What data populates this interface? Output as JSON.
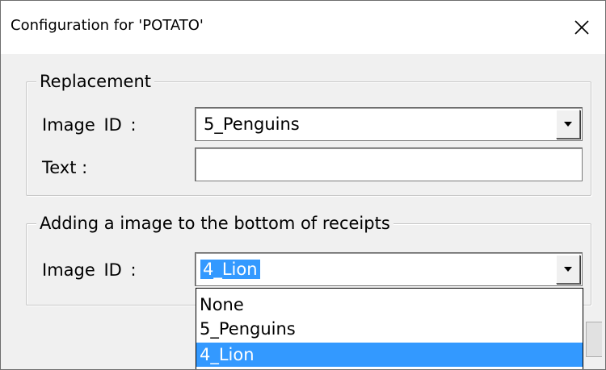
{
  "window": {
    "title": "Configuration for 'POTATO'",
    "close_icon": "close-icon"
  },
  "replacement": {
    "legend": "Replacement",
    "image_id_label": "Image  ID :",
    "image_id_value": "5_Penguins",
    "text_label": "Text :",
    "text_value": ""
  },
  "receipt_bottom": {
    "legend": "Adding a image to the bottom of receipts",
    "image_id_label": "Image  ID :",
    "image_id_value": "4_Lion",
    "dropdown_open": true,
    "options": [
      "None",
      "5_Penguins",
      "4_Lion"
    ],
    "highlighted_option": "4_Lion"
  },
  "colors": {
    "selection": "#3399ff",
    "dialog_bg": "#f0f0f0"
  }
}
